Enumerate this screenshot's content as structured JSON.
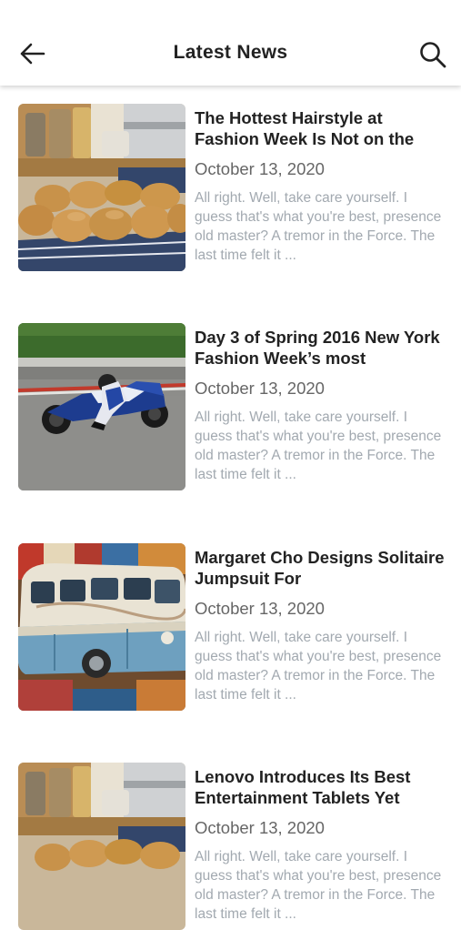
{
  "header": {
    "title": "Latest News",
    "back_icon": "arrow-left-icon",
    "search_icon": "search-icon"
  },
  "articles": [
    {
      "title": "The Hottest Hairstyle at Fashion Week Is Not on the",
      "date": "October 13, 2020",
      "excerpt": "All right. Well, take care yourself. I guess that's what you're best, presence old master? A tremor in the Force. The last time felt it ...",
      "image": "potatoes-photo"
    },
    {
      "title": "Day 3 of Spring 2016 New York Fashion Week’s most",
      "date": "October 13, 2020",
      "excerpt": "All right. Well, take care yourself. I guess that's what you're best, presence old master? A tremor in the Force. The last time felt it ...",
      "image": "motorcycle-racer-photo"
    },
    {
      "title": "Margaret Cho Designs Solitaire Jumpsuit For",
      "date": "October 13, 2020",
      "excerpt": "All right. Well, take care yourself. I guess that's what you're best, presence old master? A tremor in the Force. The last time felt it ...",
      "image": "vintage-van-painting"
    },
    {
      "title": "Lenovo Introduces Its Best Entertainment Tablets Yet",
      "date": "October 13, 2020",
      "excerpt": "All right. Well, take care yourself. I guess that's what you're best, presence old master? A tremor in the Force. The last time felt it ...",
      "image": "potatoes-photo"
    }
  ]
}
